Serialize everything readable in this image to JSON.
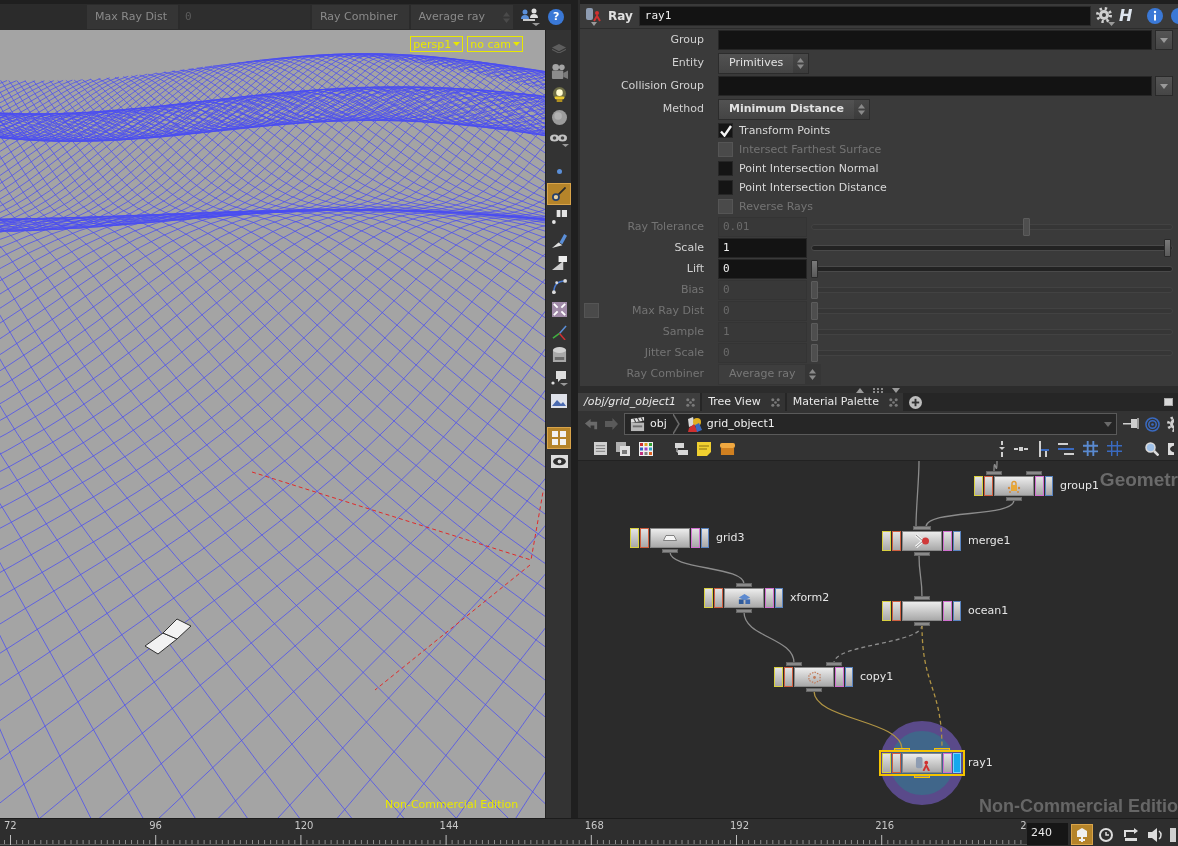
{
  "viewport_bar": {
    "items": [
      {
        "kind": "label",
        "text": "Max Ray Dist",
        "disabled": true
      },
      {
        "kind": "field",
        "text": "0",
        "disabled": true
      },
      {
        "kind": "label",
        "text": "Ray Combiner",
        "disabled": true
      },
      {
        "kind": "menu",
        "text": "Average ray",
        "disabled": true
      }
    ],
    "help": "?"
  },
  "viewport": {
    "view_menus": [
      "persp1",
      "no cam"
    ],
    "edition_label": "Non-Commercial Edition",
    "tool_groups": [
      {
        "tools": [
          {
            "kind": "layers",
            "selected": false
          },
          {
            "kind": "camera",
            "selected": false
          },
          {
            "kind": "light",
            "selected": false
          },
          {
            "kind": "sphere",
            "selected": false
          },
          {
            "kind": "glasses",
            "selected": false
          }
        ]
      },
      {
        "tools": [
          {
            "kind": "dot",
            "selected": false
          },
          {
            "kind": "pin",
            "selected": true
          },
          {
            "kind": "labels",
            "selected": false
          },
          {
            "kind": "brush",
            "selected": false
          },
          {
            "kind": "triangle",
            "selected": false
          },
          {
            "kind": "curve",
            "selected": false
          },
          {
            "kind": "shrink",
            "selected": false
          },
          {
            "kind": "axes",
            "selected": false
          },
          {
            "kind": "cylinder",
            "selected": false
          },
          {
            "kind": "bubble",
            "selected": false
          },
          {
            "kind": "picture",
            "selected": false
          }
        ]
      },
      {
        "tools": [
          {
            "kind": "grid",
            "selected": true
          },
          {
            "kind": "eye",
            "selected": false
          }
        ]
      }
    ]
  },
  "parameters": {
    "node_type": "Ray",
    "node_name": "ray1",
    "help_glyph": "H",
    "rows": [
      {
        "kind": "string",
        "label": "Group",
        "disabled": false,
        "modified": false
      },
      {
        "kind": "menu",
        "label": "Entity",
        "value": "Primitives",
        "disabled": false,
        "modified": false
      },
      {
        "kind": "string",
        "label": "Collision Group",
        "disabled": false,
        "modified": false
      },
      {
        "kind": "menu",
        "label": "Method",
        "value": "Minimum Distance",
        "disabled": false,
        "modified": true
      },
      {
        "kind": "toggle",
        "label": "Transform Points",
        "checked": true,
        "disabled": false,
        "modified": false
      },
      {
        "kind": "toggle",
        "label": "Intersect Farthest Surface",
        "checked": false,
        "disabled": true,
        "modified": false
      },
      {
        "kind": "toggle",
        "label": "Point Intersection Normal",
        "checked": false,
        "disabled": false,
        "modified": false
      },
      {
        "kind": "toggle",
        "label": "Point Intersection Distance",
        "checked": false,
        "disabled": false,
        "modified": false
      },
      {
        "kind": "toggle",
        "label": "Reverse Rays",
        "checked": false,
        "disabled": true,
        "modified": false
      },
      {
        "kind": "slider",
        "label": "Ray Tolerance",
        "value": "0.01",
        "level": 0.6,
        "disabled": true,
        "modified": false
      },
      {
        "kind": "slider",
        "label": "Scale",
        "value": "1",
        "level": 1,
        "disabled": false,
        "modified": false
      },
      {
        "kind": "slider",
        "label": "Lift",
        "value": "0",
        "level": 0,
        "disabled": false,
        "modified": false
      },
      {
        "kind": "slider",
        "label": "Bias",
        "value": "0",
        "level": 0,
        "disabled": true,
        "modified": false
      },
      {
        "kind": "slider",
        "label": "Max Ray Dist",
        "value": "0",
        "level": 0,
        "disabled": true,
        "modified": false,
        "enable": {
          "checked": false
        }
      },
      {
        "kind": "slider",
        "label": "Sample",
        "value": "1",
        "level": 0,
        "disabled": true,
        "modified": false
      },
      {
        "kind": "slider",
        "label": "Jitter Scale",
        "value": "0",
        "level": 0,
        "disabled": true,
        "modified": false
      },
      {
        "kind": "menu",
        "label": "Ray Combiner",
        "value": "Average ray",
        "disabled": true,
        "modified": false
      }
    ]
  },
  "network": {
    "tabs": [
      {
        "label": "/obj/grid_object1",
        "selected": true
      },
      {
        "label": "Tree View",
        "selected": false
      },
      {
        "label": "Material Palette",
        "selected": false
      }
    ],
    "path": [
      {
        "kind": "network",
        "label": "obj"
      },
      {
        "kind": "geometry",
        "label": "grid_object1"
      }
    ],
    "context_label": "Geometr",
    "edition_label": "Non-Commercial Editio",
    "nodes": [
      {
        "name": "group1",
        "kind": "group",
        "selected": false,
        "display": false,
        "inputs": [
          {
            "dashed": false
          }
        ]
      },
      {
        "name": "merge1",
        "kind": "merge",
        "selected": false,
        "display": false,
        "inputs": [
          {
            "dashed": false
          },
          {
            "dashed": false
          }
        ]
      },
      {
        "name": "grid3",
        "kind": "grid",
        "selected": false,
        "display": false
      },
      {
        "name": "xform2",
        "kind": "xform",
        "selected": false,
        "display": false,
        "inputs": [
          {
            "dashed": false
          }
        ]
      },
      {
        "name": "ocean1",
        "kind": "ocean",
        "selected": false,
        "display": false,
        "inputs": [
          {
            "dashed": false
          }
        ]
      },
      {
        "name": "copy1",
        "kind": "copy",
        "selected": false,
        "display": false,
        "inputs": [
          {
            "dashed": false
          },
          {
            "dashed": true
          }
        ]
      },
      {
        "name": "ray1",
        "kind": "ray",
        "selected": true,
        "display": true,
        "inputs": [
          {
            "dashed": false
          },
          {
            "dashed": true
          }
        ]
      }
    ]
  },
  "timeline": {
    "frame_labels": [
      "72",
      "96",
      "120",
      "144",
      "168",
      "192",
      "216",
      "2"
    ],
    "end_frame": "240"
  }
}
